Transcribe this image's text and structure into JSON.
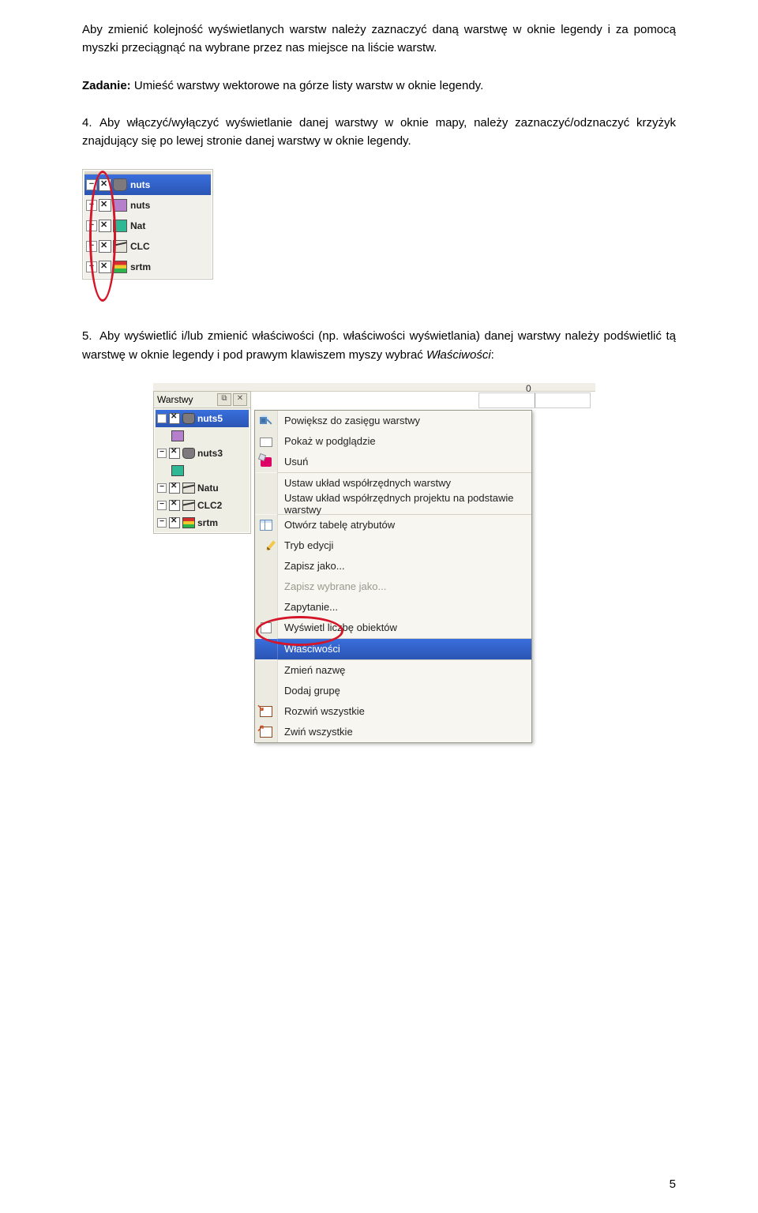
{
  "para1": "Aby zmienić kolejność wyświetlanych warstw należy zaznaczyć daną warstwę w oknie legendy i za pomocą myszki przeciągnąć na wybrane przez nas miejsce na liście warstw.",
  "task": {
    "label": "Zadanie:",
    "text": " Umieść warstwy wektorowe na górze listy warstw w oknie legendy."
  },
  "item4": {
    "num": "4.",
    "text": "Aby włączyć/wyłączyć wyświetlanie danej warstwy w oknie mapy, należy zaznaczyć/odznaczyć krzyżyk znajdujący się po lewej stronie danej warstwy w oknie legendy."
  },
  "item5": {
    "num": "5.",
    "text": "Aby wyświetlić i/lub zmienić właściwości (np. właściwości wyświetlania) danej warstwy należy podświetlić tą warstwę w oknie legendy i pod prawym klawiszem myszy wybrać ",
    "italic": "Właściwości",
    "suffix": ":"
  },
  "shot1": {
    "layers": [
      {
        "label": "nuts",
        "swatch": "sw-grey-poly",
        "selected": true
      },
      {
        "label": "nuts",
        "swatch": "sw-purple",
        "selected": false
      },
      {
        "label": "Nat",
        "swatch": "sw-teal",
        "selected": false
      },
      {
        "label": "CLC",
        "swatch": "sw-wave",
        "selected": false
      },
      {
        "label": "srtm",
        "swatch": "sw-rainbow",
        "selected": false
      }
    ]
  },
  "shot2": {
    "panel_title": "Warstwy",
    "pin_glyph": "⧉",
    "close_glyph": "✕",
    "ruler_zero": "0",
    "layers": [
      {
        "label": "nuts5",
        "swatch": "sw-grey-poly",
        "selected": true,
        "sub": false
      },
      {
        "label": "",
        "swatch": "sw-purple",
        "selected": false,
        "sub": true
      },
      {
        "label": "nuts3",
        "swatch": "sw-grey-poly",
        "selected": false,
        "sub": false
      },
      {
        "label": "",
        "swatch": "sw-teal",
        "selected": false,
        "sub": true
      },
      {
        "label": "Natu",
        "swatch": "sw-wave",
        "selected": false,
        "sub": false
      },
      {
        "label": "CLC2",
        "swatch": "sw-wave",
        "selected": false,
        "sub": false
      },
      {
        "label": "srtm",
        "swatch": "sw-rainbow",
        "selected": false,
        "sub": false
      }
    ],
    "menu": [
      {
        "label": "Powiększ do zasięgu warstwy",
        "icon": "ico-zoom",
        "disabled": false,
        "selected": false
      },
      {
        "label": "Pokaż w podglądzie",
        "icon": "ico-rect",
        "disabled": false,
        "selected": false
      },
      {
        "label": "Usuń",
        "icon": "ico-del2",
        "disabled": false,
        "selected": false,
        "sep_after": true
      },
      {
        "label": "Ustaw układ współrzędnych warstwy",
        "icon": "",
        "disabled": false,
        "selected": false
      },
      {
        "label": "Ustaw układ współrzędnych projektu na podstawie warstwy",
        "icon": "",
        "disabled": false,
        "selected": false,
        "sep_after": true
      },
      {
        "label": "Otwórz tabelę atrybutów",
        "icon": "ico-table",
        "disabled": false,
        "selected": false
      },
      {
        "label": "Tryb edycji",
        "icon": "ico-pencil",
        "disabled": false,
        "selected": false
      },
      {
        "label": "Zapisz jako...",
        "icon": "",
        "disabled": false,
        "selected": false
      },
      {
        "label": "Zapisz wybrane jako...",
        "icon": "",
        "disabled": true,
        "selected": false
      },
      {
        "label": "Zapytanie...",
        "icon": "",
        "disabled": false,
        "selected": false
      },
      {
        "label": "Wyświetl liczbę obiektów",
        "icon": "ico-cb",
        "disabled": false,
        "selected": false,
        "sep_after": true
      },
      {
        "label": "Właściwości",
        "icon": "",
        "disabled": false,
        "selected": true,
        "sep_after": true
      },
      {
        "label": "Zmień nazwę",
        "icon": "",
        "disabled": false,
        "selected": false
      },
      {
        "label": "Dodaj grupę",
        "icon": "",
        "disabled": false,
        "selected": false
      },
      {
        "label": "Rozwiń wszystkie",
        "icon": "ico-expand",
        "disabled": false,
        "selected": false
      },
      {
        "label": "Zwiń wszystkie",
        "icon": "ico-collapse",
        "disabled": false,
        "selected": false
      }
    ]
  },
  "page_number": "5"
}
